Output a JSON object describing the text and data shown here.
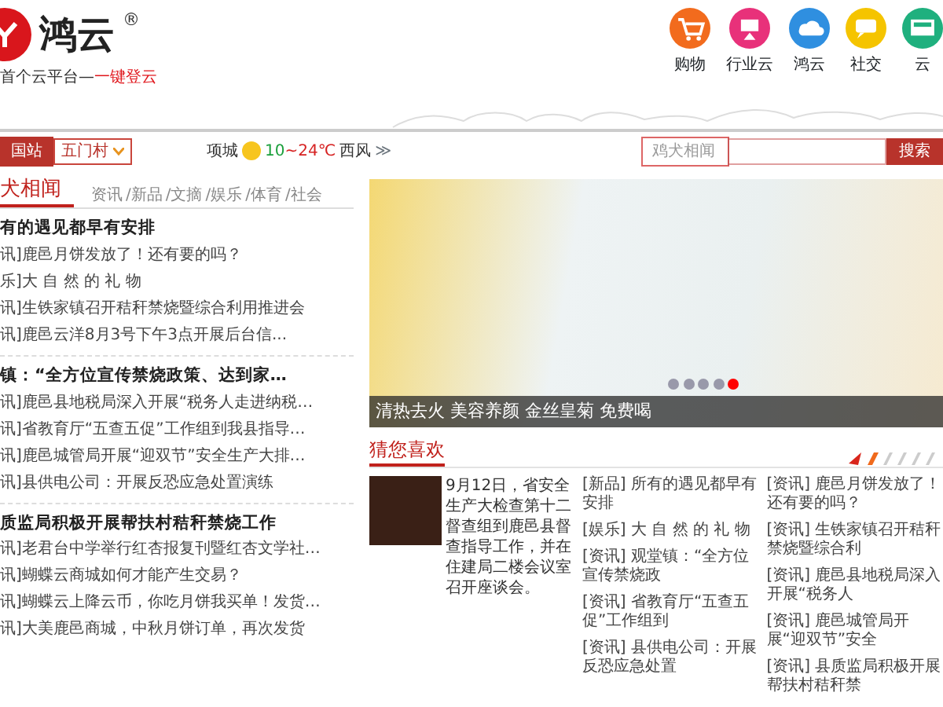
{
  "logo": {
    "name": "鸿云",
    "mark": "®",
    "tagline": "首个云平台—",
    "tagline_highlight": "一键登云"
  },
  "apps": [
    {
      "label": "购物",
      "kind": "cart",
      "color": "#f26b1d"
    },
    {
      "label": "行业云",
      "kind": "industry",
      "color": "#e8317a"
    },
    {
      "label": "鸿云",
      "kind": "cloud",
      "color": "#2f8fe0"
    },
    {
      "label": "社交",
      "kind": "chat",
      "color": "#f5c400"
    },
    {
      "label": "云",
      "kind": "screen",
      "color": "#1fb07e"
    }
  ],
  "station": {
    "label": "国站",
    "village": "五门村"
  },
  "weather": {
    "city": "项城",
    "low": "10",
    "high": "~24℃",
    "wind": "西风",
    "more": "≫"
  },
  "search": {
    "category": "鸡犬相闻",
    "button": "搜索"
  },
  "news": {
    "title": "犬相闻",
    "tabs": [
      {
        "label": "资讯",
        "selected": false
      },
      {
        "label": "/新品",
        "selected": false
      },
      {
        "label": "/文摘",
        "selected": false
      },
      {
        "label": "/娱乐",
        "selected": false
      },
      {
        "label": "/体育",
        "selected": false
      },
      {
        "label": "/社会",
        "selected": false
      }
    ],
    "groups": [
      {
        "headline": "有的遇见都早有安排",
        "items": [
          "讯]鹿邑月饼发放了！还有要的吗？",
          "乐]大 自 然 的 礼 物",
          "讯]生铁家镇召开秸秆禁烧暨综合利用推进会",
          "讯]鹿邑云洋8月3号下午3点开展后台信..."
        ]
      },
      {
        "headline": "镇：“全方位宣传禁烧政策、达到家…",
        "items": [
          "讯]鹿邑县地税局深入开展“税务人走进纳税…",
          "讯]省教育厅“五查五促”工作组到我县指导…",
          "讯]鹿邑城管局开展“迎双节”安全生产大排…",
          "讯]县供电公司：开展反恐应急处置演练"
        ]
      },
      {
        "headline": "质监局积极开展帮扶村秸秆禁烧工作",
        "items": [
          "讯]老君台中学举行红杏报复刊暨红杏文学社…",
          "讯]蝴蝶云商城如何才能产生交易？",
          "讯]蝴蝶云上降云币，你吃月饼我买单！发货…",
          "讯]大美鹿邑商城，中秋月饼订单，再次发货"
        ]
      }
    ]
  },
  "banner": {
    "caption": "清热去火 美容养颜 金丝皇菊 免费喝",
    "dots": [
      {
        "selected": false
      },
      {
        "selected": false
      },
      {
        "selected": false
      },
      {
        "selected": false
      },
      {
        "selected": true
      }
    ]
  },
  "recommend": {
    "title": "猜您喜欢",
    "feature": "9月12日，省安全生产大检查第十二督查组到鹿邑县督查指导工作，并在住建局二楼会议室召开座谈会。",
    "lists": [
      [
        {
          "tag": "[新品]",
          "text": "所有的遇见都早有安排"
        },
        {
          "tag": "[娱乐]",
          "text": "大 自 然 的 礼 物"
        },
        {
          "tag": "[资讯]",
          "text": "观堂镇：“全方位宣传禁烧政"
        },
        {
          "tag": "[资讯]",
          "text": "省教育厅“五查五促”工作组到"
        },
        {
          "tag": "[资讯]",
          "text": "县供电公司：开展反恐应急处置"
        }
      ],
      [
        {
          "tag": "[资讯]",
          "text": "鹿邑月饼发放了！还有要的吗？"
        },
        {
          "tag": "[资讯]",
          "text": "生铁家镇召开秸秆禁烧暨综合利"
        },
        {
          "tag": "[资讯]",
          "text": "鹿邑县地税局深入开展“税务人"
        },
        {
          "tag": "[资讯]",
          "text": "鹿邑城管局开展“迎双节”安全"
        },
        {
          "tag": "[资讯]",
          "text": "县质监局积极开展帮扶村秸秆禁"
        }
      ]
    ]
  }
}
